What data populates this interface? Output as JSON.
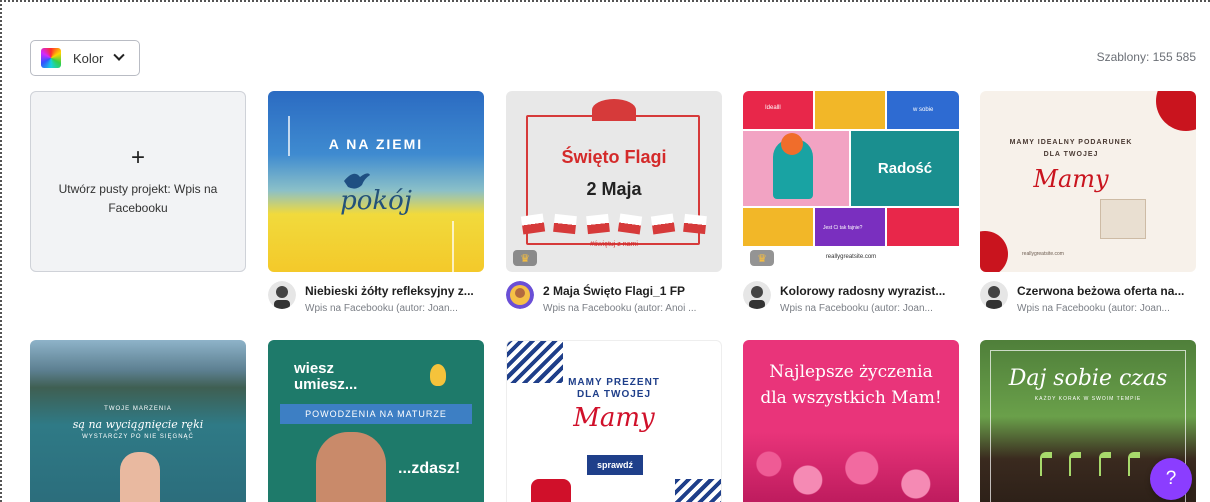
{
  "filter": {
    "color_label": "Kolor"
  },
  "template_count": "Szablony: 155 585",
  "create_card": {
    "plus": "+",
    "label": "Utwórz pusty projekt: Wpis na Facebooku"
  },
  "row1": [
    {
      "title": "Niebieski żółty refleksyjny z...",
      "subtitle": "Wpis na Facebooku (autor: Joan...",
      "lines": [
        "A NA ZIEMI",
        "pokój"
      ]
    },
    {
      "title": "2 Maja Święto Flagi_1 FP",
      "subtitle": "Wpis na Facebooku (autor: Anoi ...",
      "lines": [
        "Święto Flagi",
        "2 Maja",
        "#świętuj z nami"
      ]
    },
    {
      "title": "Kolorowy radosny wyrazist...",
      "subtitle": "Wpis na Facebooku (autor: Joan...",
      "lines": [
        "Radość",
        "Idealll",
        "w sobie",
        "Jest Ci tak fajnie?",
        "reallygreatsite.com"
      ]
    },
    {
      "title": "Czerwona beżowa oferta na...",
      "subtitle": "Wpis na Facebooku (autor: Joan...",
      "lines": [
        "MAMY IDEALNY PODARUNEK",
        "DLA TWOJEJ",
        "Mamy",
        "reallygreatsite.com"
      ]
    }
  ],
  "row2": [
    {
      "lines": [
        "TWOJE MARZENIA",
        "są na wyciągnięcie ręki",
        "WYSTARCZY PO NIE SIĘGNĄĆ"
      ]
    },
    {
      "lines": [
        "wiesz",
        "umiesz...",
        "POWODZENIA NA MATURZE",
        "...zdasz!"
      ]
    },
    {
      "lines": [
        "MAMY PREZENT",
        "DLA TWOJEJ",
        "Mamy",
        "sprawdź"
      ]
    },
    {
      "lines": [
        "Najlepsze życzenia",
        "dla wszystkich Mam!"
      ]
    },
    {
      "lines": [
        "Daj sobie czas",
        "KAŻDY KORAK W SWOIM TEMPIE"
      ]
    }
  ],
  "help": {
    "label": "?"
  },
  "colors": {
    "accent": "#8b3dff",
    "red": "#d42a2a",
    "teal": "#1a8f8f"
  }
}
